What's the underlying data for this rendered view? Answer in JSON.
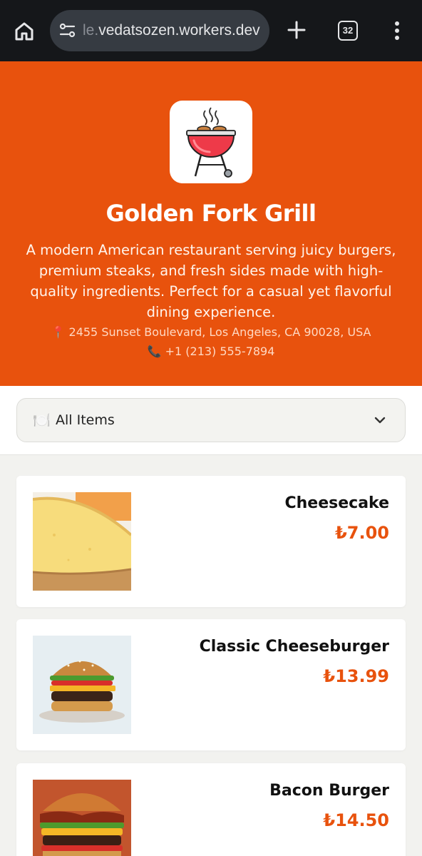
{
  "browser": {
    "url_hidden_prefix": "le.",
    "url_visible": "vedatsozen.workers.dev",
    "tab_count": "32",
    "icons": [
      "home-icon",
      "site-settings-icon",
      "new-tab-icon",
      "tab-switcher-icon",
      "more-options-icon"
    ]
  },
  "restaurant": {
    "name": "Golden Fork Grill",
    "description": "A modern American restaurant serving juicy burgers, premium steaks, and fresh sides made with high-quality ingredients. Perfect for a casual yet flavorful dining experience.",
    "address_icon": "📍",
    "address": "2455 Sunset Boulevard, Los Angeles, CA 90028, USA",
    "phone_icon": "📞",
    "phone": "+1 (213) 555-7894",
    "brand_color": "#e8520d"
  },
  "filter": {
    "icon": "🍽️",
    "selected": "All Items"
  },
  "menu_items": [
    {
      "name": "Cheesecake",
      "price": "₺7.00",
      "image": "cheesecake-photo"
    },
    {
      "name": "Classic Cheeseburger",
      "price": "₺13.99",
      "image": "cheeseburger-photo"
    },
    {
      "name": "Bacon Burger",
      "price": "₺14.50",
      "image": "bacon-burger-photo"
    }
  ]
}
